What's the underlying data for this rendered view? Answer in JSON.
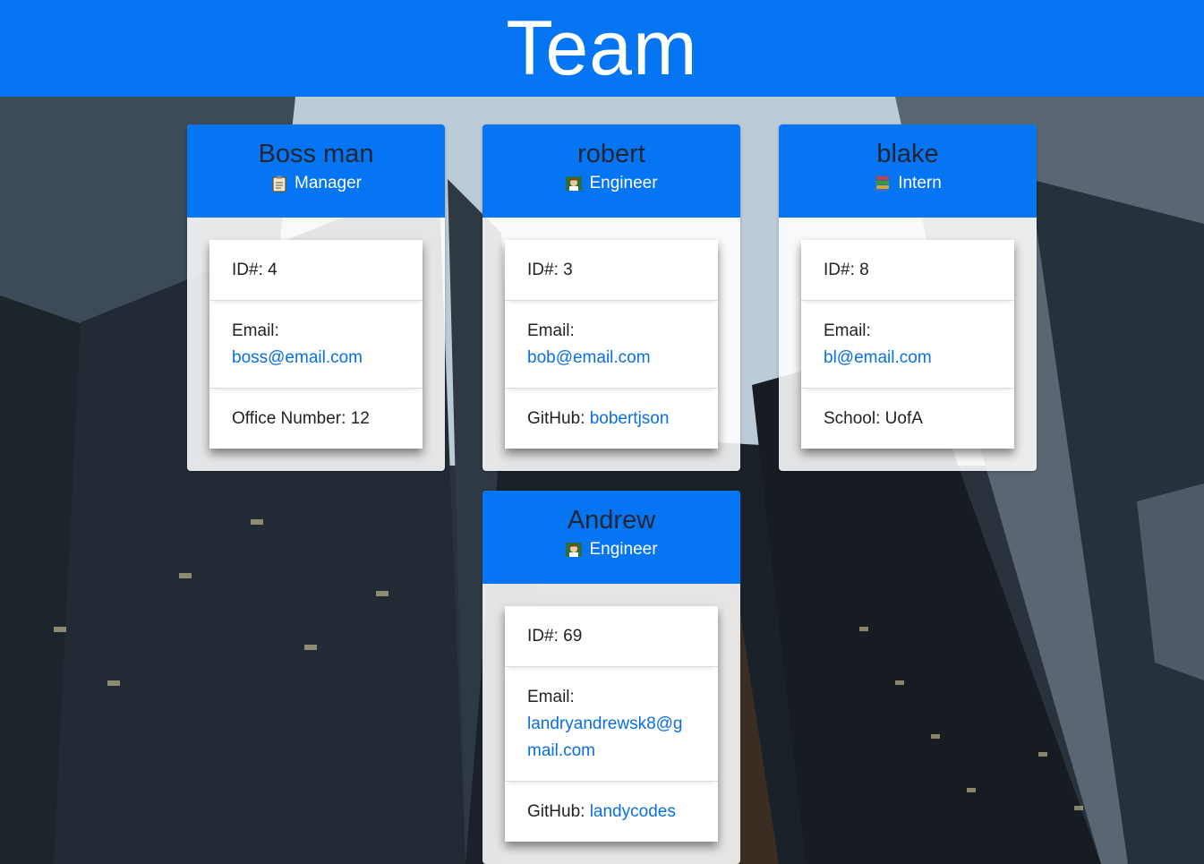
{
  "header": {
    "title": "Team"
  },
  "colors": {
    "header_bg": "#0575f4",
    "link": "#0a6fe0"
  },
  "cards": [
    {
      "name": "Boss man",
      "role": "Manager",
      "role_icon": "clipboard-icon",
      "id_label": "ID#: 4",
      "email_label": "Email:",
      "email": "boss@email.com",
      "extra_label": "Office Number: 12",
      "extra_link": ""
    },
    {
      "name": "robert",
      "role": "Engineer",
      "role_icon": "engineer-icon",
      "id_label": "ID#: 3",
      "email_label": "Email:",
      "email": "bob@email.com",
      "extra_label": "GitHub: ",
      "extra_link": "bobertjson"
    },
    {
      "name": "blake",
      "role": "Intern",
      "role_icon": "books-icon",
      "id_label": "ID#: 8",
      "email_label": "Email:",
      "email": "bl@email.com",
      "extra_label": "School: UofA",
      "extra_link": ""
    },
    {
      "name": "Andrew",
      "role": "Engineer",
      "role_icon": "engineer-icon",
      "id_label": "ID#: 69",
      "email_label": "Email:",
      "email": "landryandrewsk8@gmail.com",
      "extra_label": "GitHub: ",
      "extra_link": "landycodes"
    }
  ]
}
